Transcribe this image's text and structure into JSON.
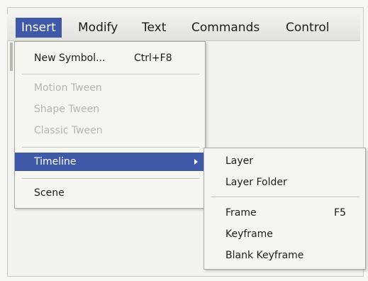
{
  "menubar": {
    "items": [
      {
        "label": "Insert",
        "active": true
      },
      {
        "label": "Modify"
      },
      {
        "label": "Text"
      },
      {
        "label": "Commands"
      },
      {
        "label": "Control"
      }
    ]
  },
  "insert_menu": {
    "new_symbol": {
      "label": "New Symbol...",
      "shortcut": "Ctrl+F8"
    },
    "motion_tween": {
      "label": "Motion Tween"
    },
    "shape_tween": {
      "label": "Shape Tween"
    },
    "classic_tween": {
      "label": "Classic Tween"
    },
    "timeline": {
      "label": "Timeline"
    },
    "scene": {
      "label": "Scene"
    }
  },
  "timeline_submenu": {
    "layer": {
      "label": "Layer"
    },
    "layer_folder": {
      "label": "Layer Folder"
    },
    "frame": {
      "label": "Frame",
      "shortcut": "F5"
    },
    "keyframe": {
      "label": "Keyframe"
    },
    "blank_keyframe": {
      "label": "Blank Keyframe"
    }
  },
  "colors": {
    "highlight": "#3f58a8",
    "menu_bg": "#f5f5f2",
    "disabled_text": "#b5b5b0"
  }
}
